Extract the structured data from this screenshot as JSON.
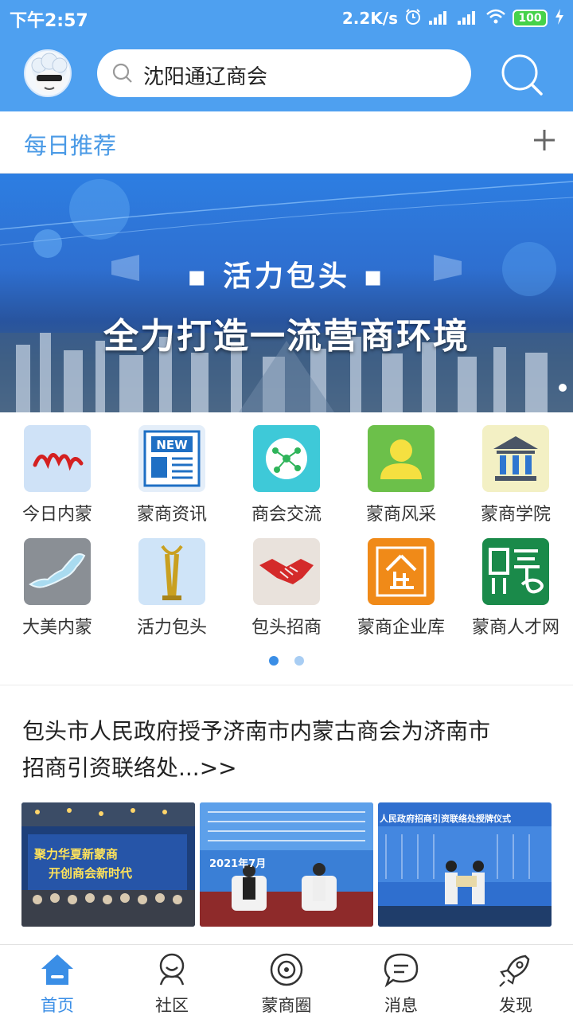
{
  "status_bar": {
    "time": "下午2:57",
    "net_speed": "2.2K/s",
    "battery": "100",
    "icons": [
      "alarm-icon",
      "signal-icon",
      "signal-icon",
      "wifi-icon",
      "battery-icon",
      "charging-icon"
    ]
  },
  "header": {
    "search_text": "沈阳通辽商会",
    "icons": [
      "avatar-icon",
      "search-icon"
    ]
  },
  "recommend": {
    "title": "每日推荐",
    "icon": "plus-icon"
  },
  "banner": {
    "subtitle": "▪ 活力包头 ▪",
    "main_text": "全力打造一流营商环境"
  },
  "grid": {
    "items": [
      {
        "label": "今日内蒙",
        "icon": "neimeng-calligraphy-icon"
      },
      {
        "label": "蒙商资讯",
        "icon": "news-icon"
      },
      {
        "label": "商会交流",
        "icon": "network-icon"
      },
      {
        "label": "蒙商风采",
        "icon": "person-icon"
      },
      {
        "label": "蒙商学院",
        "icon": "academy-icon"
      },
      {
        "label": "大美内蒙",
        "icon": "map-icon"
      },
      {
        "label": "活力包头",
        "icon": "sculpture-icon"
      },
      {
        "label": "包头招商",
        "icon": "handshake-icon"
      },
      {
        "label": "蒙商企业库",
        "icon": "enterprise-icon"
      },
      {
        "label": "蒙商人才网",
        "icon": "recruit-icon"
      }
    ],
    "page_count": 2,
    "active_page": 1
  },
  "news": {
    "title_line1": "包头市人民政府授予济南市内蒙古商会为济南市",
    "title_line2": "招商引资联络处...>>",
    "image1_text": "聚力华夏新蒙商",
    "image1_text2": "开创商会新时代",
    "image2_text": "2021年7月",
    "image3_text": "人民政府招商引资联络处授牌仪式"
  },
  "bottom_nav": {
    "items": [
      {
        "label": "首页",
        "icon": "home-icon",
        "active": true
      },
      {
        "label": "社区",
        "icon": "community-icon",
        "active": false
      },
      {
        "label": "蒙商圈",
        "icon": "circle-icon",
        "active": false
      },
      {
        "label": "消息",
        "icon": "message-icon",
        "active": false
      },
      {
        "label": "发现",
        "icon": "rocket-icon",
        "active": false
      }
    ]
  },
  "colors": {
    "primary": "#4ea0f0",
    "active_nav": "#3a8ee6",
    "pager_active": "#3a8ee6",
    "pager_inactive": "#a8cdf3"
  }
}
